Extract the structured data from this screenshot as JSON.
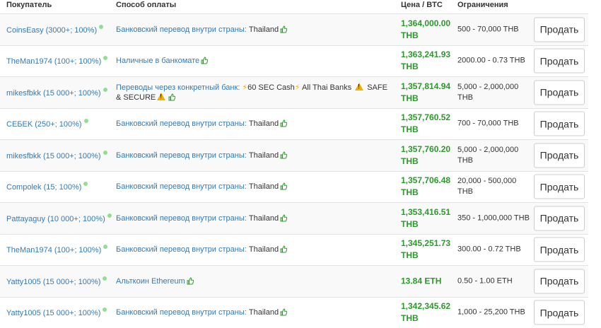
{
  "header": {
    "buyer": "Покупатель",
    "payment": "Способ оплаты",
    "price": "Цена / BTC",
    "limits": "Ограничения"
  },
  "rows": [
    {
      "buyer": "CoinsEasy (3000+; 100%)",
      "method": "Банковский перевод внутри страны:",
      "country": "Thailand",
      "price": "1,364,000.00 THB",
      "limits": "500 - 70,000 THB",
      "action": "Продать"
    },
    {
      "buyer": "TheMan1974 (100+; 100%)",
      "method": "Наличные в банкомате",
      "country": "",
      "price": "1,363,241.93 THB",
      "limits": "2000.00 - 0.73 THB",
      "action": "Продать"
    },
    {
      "buyer": "mikesfbkk (15 000+; 100%)",
      "method": "Переводы через конкретный банк:",
      "extra1": "60 SEC Cash",
      "extra2": "All Thai Banks",
      "extra3": "SAFE & SECURE",
      "price": "1,357,814.94 THB",
      "limits": "5,000 - 2,000,000 THB",
      "action": "Продать"
    },
    {
      "buyer": "CEБEK (250+; 100%)",
      "method": "Банковский перевод внутри страны:",
      "country": "Thailand",
      "price": "1,357,760.52 THB",
      "limits": "700 - 70,000 THB",
      "action": "Продать"
    },
    {
      "buyer": "mikesfbkk (15 000+; 100%)",
      "method": "Банковский перевод внутри страны:",
      "country": "Thailand",
      "price": "1,357,760.20 THB",
      "limits": "5,000 - 2,000,000 THB",
      "action": "Продать"
    },
    {
      "buyer": "Compolek (15; 100%)",
      "method": "Банковский перевод внутри страны:",
      "country": "Thailand",
      "price": "1,357,706.48 THB",
      "limits": "20,000 - 500,000 THB",
      "action": "Продать"
    },
    {
      "buyer": "Pattayaguy (10 000+; 100%)",
      "method": "Банковский перевод внутри страны:",
      "country": "Thailand",
      "price": "1,353,416.51 THB",
      "limits": "350 - 1,000,000 THB",
      "action": "Продать"
    },
    {
      "buyer": "TheMan1974 (100+; 100%)",
      "method": "Банковский перевод внутри страны:",
      "country": "Thailand",
      "price": "1,345,251.73 THB",
      "limits": "300.00 - 0.72 THB",
      "action": "Продать"
    },
    {
      "buyer": "Yatty1005 (15 000+; 100%)",
      "method": "Альткоин Ethereum",
      "country": "",
      "price": "13.84 ETH",
      "limits": "0.50 - 1.00 ETH",
      "action": "Продать"
    },
    {
      "buyer": "Yatty1005 (15 000+; 100%)",
      "method": "Банковский перевод внутри страны:",
      "country": "Thailand",
      "price": "1,342,345.62 THB",
      "limits": "1,000 - 25,200 THB",
      "action": "Продать"
    }
  ],
  "colors": {
    "link": "#337ab7",
    "price": "#2a9a2a",
    "online": "#8fe08f",
    "stripe": "#f9f9f9"
  }
}
